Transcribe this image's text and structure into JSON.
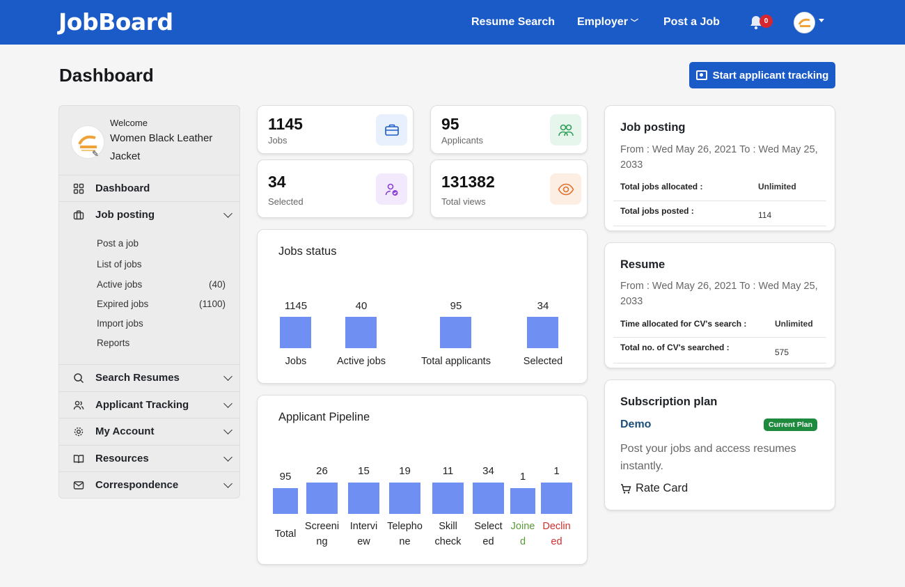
{
  "header": {
    "brand": "JobBoard",
    "nav": [
      "Resume Search",
      "Employer",
      "Post a Job"
    ],
    "notification_count": "0"
  },
  "page": {
    "title": "Dashboard",
    "start_tracking_label": "Start applicant tracking"
  },
  "sidebar": {
    "welcome": "Welcome",
    "user_name": "Women Black Leather Jacket",
    "items": [
      {
        "label": "Dashboard",
        "icon": "grid-icon"
      },
      {
        "label": "Job posting",
        "icon": "briefcase-icon"
      },
      {
        "label": "Search Resumes",
        "icon": "search-icon"
      },
      {
        "label": "Applicant Tracking",
        "icon": "users-icon"
      },
      {
        "label": "My Account",
        "icon": "gear-icon"
      },
      {
        "label": "Resources",
        "icon": "book-icon"
      },
      {
        "label": "Correspondence",
        "icon": "mail-icon"
      }
    ],
    "job_posting_sub": [
      {
        "label": "Post a job",
        "count": ""
      },
      {
        "label": "List of jobs",
        "count": ""
      },
      {
        "label": "Active jobs",
        "count": "(40)"
      },
      {
        "label": "Expired jobs",
        "count": "(1100)"
      },
      {
        "label": "Import jobs",
        "count": ""
      },
      {
        "label": "Reports",
        "count": ""
      }
    ]
  },
  "stats": [
    {
      "value": "1145",
      "label": "Jobs",
      "icon": "briefcase-icon",
      "color": "#1a5bc8"
    },
    {
      "value": "95",
      "label": "Applicants",
      "icon": "users-icon",
      "color": "#2e9e58"
    },
    {
      "value": "34",
      "label": "Selected",
      "icon": "user-check-icon",
      "color": "#8b3fd9"
    },
    {
      "value": "131382",
      "label": "Total views",
      "icon": "eye-icon",
      "color": "#e2702d"
    }
  ],
  "jobs_status": {
    "title": "Jobs status",
    "bars": [
      {
        "label": "Jobs",
        "value": "1145"
      },
      {
        "label": "Active jobs",
        "value": "40"
      },
      {
        "label": "Total applicants",
        "value": "95"
      },
      {
        "label": "Selected",
        "value": "34"
      }
    ]
  },
  "pipeline": {
    "title": "Applicant Pipeline",
    "bars": [
      {
        "l1": "Total",
        "l2": "",
        "value": "95",
        "color": "#222222"
      },
      {
        "l1": "Screeni",
        "l2": "ng",
        "value": "26",
        "color": "#222222"
      },
      {
        "l1": "Intervi",
        "l2": "ew",
        "value": "15",
        "color": "#222222"
      },
      {
        "l1": "Telepho",
        "l2": "ne",
        "value": "19",
        "color": "#222222"
      },
      {
        "l1": "Skill",
        "l2": "check",
        "value": "11",
        "color": "#222222"
      },
      {
        "l1": "Select",
        "l2": "ed",
        "value": "34",
        "color": "#222222"
      },
      {
        "l1": "Joine",
        "l2": "d",
        "value": "1",
        "color": "#5a9a3a"
      },
      {
        "l1": "Declin",
        "l2": "ed",
        "value": "1",
        "color": "#d0312d"
      }
    ]
  },
  "job_posting_panel": {
    "title": "Job posting",
    "dates": "From : Wed May 26, 2021   To : Wed May 25, 2033",
    "rows": [
      {
        "k": "Total jobs allocated :",
        "v": "Unlimited"
      },
      {
        "k": "Total jobs posted :",
        "v": "114"
      }
    ]
  },
  "resume_panel": {
    "title": "Resume",
    "dates": "From : Wed May 26, 2021   To : Wed May 25, 2033",
    "rows": [
      {
        "k": "Time allocated for CV's search :",
        "v": "Unlimited"
      },
      {
        "k": "Total no. of CV's searched :",
        "v": "575"
      }
    ]
  },
  "subscription": {
    "title": "Subscription plan",
    "plan": "Demo",
    "badge": "Current Plan",
    "desc": "Post your jobs and access resumes instantly.",
    "rate_card": "Rate Card"
  }
}
